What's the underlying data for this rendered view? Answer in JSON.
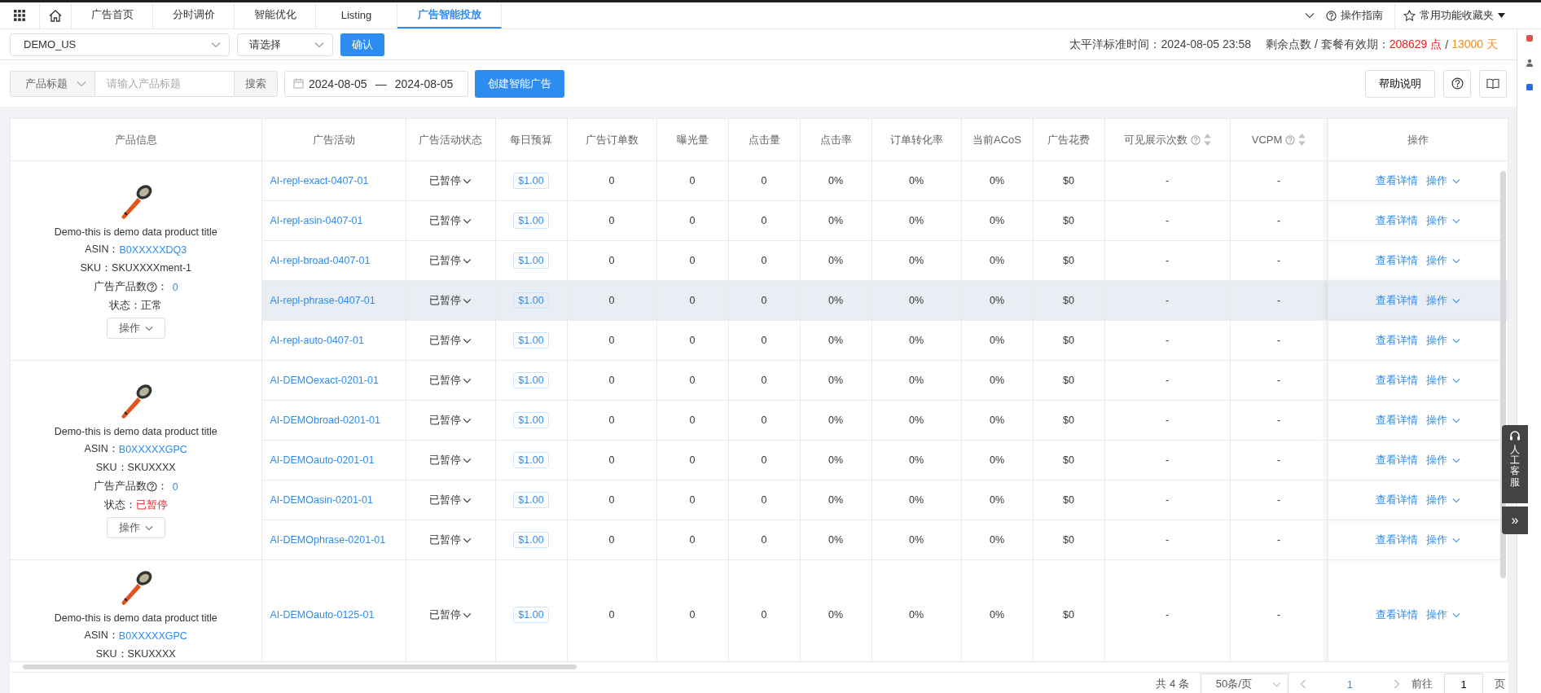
{
  "top_nav": {
    "tabs": [
      {
        "label": "广告首页",
        "selected": false
      },
      {
        "label": "分时调价",
        "selected": false
      },
      {
        "label": "智能优化",
        "selected": false
      },
      {
        "label": "Listing",
        "selected": false
      },
      {
        "label": "广告智能投放",
        "selected": true
      }
    ],
    "guide": "操作指南",
    "favorites": "常用功能收藏夹"
  },
  "account_bar": {
    "store": "DEMO_US",
    "select_placeholder": "请选择",
    "confirm": "确认",
    "time": "太平洋标准时间：2024-08-05 23:58",
    "points_label": "剩余点数 / 套餐有效期：",
    "points": "208629 点",
    "separator": "/",
    "days": "13000 天"
  },
  "filters": {
    "field": "产品标题",
    "search_placeholder": "请输入产品标题",
    "search_button": "搜索",
    "date_start": "2024-08-05",
    "date_sep": "—",
    "date_end": "2024-08-05",
    "create_button": "创建智能广告",
    "help_button": "帮助说明"
  },
  "table": {
    "columns": [
      {
        "label": "产品信息",
        "help": false,
        "sortable": false
      },
      {
        "label": "广告活动",
        "help": false,
        "sortable": false
      },
      {
        "label": "广告活动状态",
        "help": false,
        "sortable": false
      },
      {
        "label": "每日预算",
        "help": false,
        "sortable": false
      },
      {
        "label": "广告订单数",
        "help": false,
        "sortable": false
      },
      {
        "label": "曝光量",
        "help": false,
        "sortable": false
      },
      {
        "label": "点击量",
        "help": false,
        "sortable": false
      },
      {
        "label": "点击率",
        "help": false,
        "sortable": false
      },
      {
        "label": "订单转化率",
        "help": false,
        "sortable": false
      },
      {
        "label": "当前ACoS",
        "help": false,
        "sortable": false
      },
      {
        "label": "广告花费",
        "help": false,
        "sortable": false
      },
      {
        "label": "可见展示次数",
        "help": true,
        "sortable": true
      },
      {
        "label": "VCPM",
        "help": true,
        "sortable": true
      },
      {
        "label": "操作",
        "help": false,
        "sortable": false
      }
    ],
    "products": [
      {
        "title": "Demo-this is demo data product title",
        "asin_label": "ASIN：",
        "asin": "B0XXXXXDQ3",
        "sku": "SKU：SKUXXXXment-1",
        "count_label": "广告产品数",
        "count_sep": "：",
        "count": "0",
        "status_label": "状态：",
        "status": "正常",
        "paused": false,
        "action": "操作",
        "campaigns": [
          {
            "name": "AI-repl-exact-0407-01",
            "status": "已暂停",
            "budget": "$1.00",
            "metrics": [
              "0",
              "0",
              "0",
              "0%",
              "0%",
              "0%",
              "$0",
              "-",
              "-"
            ],
            "details": "查看详情",
            "action": "操作",
            "highlighted": false
          },
          {
            "name": "AI-repl-asin-0407-01",
            "status": "已暂停",
            "budget": "$1.00",
            "metrics": [
              "0",
              "0",
              "0",
              "0%",
              "0%",
              "0%",
              "$0",
              "-",
              "-"
            ],
            "details": "查看详情",
            "action": "操作",
            "highlighted": false
          },
          {
            "name": "AI-repl-broad-0407-01",
            "status": "已暂停",
            "budget": "$1.00",
            "metrics": [
              "0",
              "0",
              "0",
              "0%",
              "0%",
              "0%",
              "$0",
              "-",
              "-"
            ],
            "details": "查看详情",
            "action": "操作",
            "highlighted": false
          },
          {
            "name": "AI-repl-phrase-0407-01",
            "status": "已暂停",
            "budget": "$1.00",
            "metrics": [
              "0",
              "0",
              "0",
              "0%",
              "0%",
              "0%",
              "$0",
              "-",
              "-"
            ],
            "details": "查看详情",
            "action": "操作",
            "highlighted": true
          },
          {
            "name": "AI-repl-auto-0407-01",
            "status": "已暂停",
            "budget": "$1.00",
            "metrics": [
              "0",
              "0",
              "0",
              "0%",
              "0%",
              "0%",
              "$0",
              "-",
              "-"
            ],
            "details": "查看详情",
            "action": "操作",
            "highlighted": false
          }
        ]
      },
      {
        "title": "Demo-this is demo data product title",
        "asin_label": "ASIN：",
        "asin": "B0XXXXXGPC",
        "sku": "SKU：SKUXXXX",
        "count_label": "广告产品数",
        "count_sep": "：",
        "count": "0",
        "status_label": "状态：",
        "status": "已暂停",
        "paused": true,
        "action": "操作",
        "campaigns": [
          {
            "name": "AI-DEMOexact-0201-01",
            "status": "已暂停",
            "budget": "$1.00",
            "metrics": [
              "0",
              "0",
              "0",
              "0%",
              "0%",
              "0%",
              "$0",
              "-",
              "-"
            ],
            "details": "查看详情",
            "action": "操作",
            "highlighted": false
          },
          {
            "name": "AI-DEMObroad-0201-01",
            "status": "已暂停",
            "budget": "$1.00",
            "metrics": [
              "0",
              "0",
              "0",
              "0%",
              "0%",
              "0%",
              "$0",
              "-",
              "-"
            ],
            "details": "查看详情",
            "action": "操作",
            "highlighted": false
          },
          {
            "name": "AI-DEMOauto-0201-01",
            "status": "已暂停",
            "budget": "$1.00",
            "metrics": [
              "0",
              "0",
              "0",
              "0%",
              "0%",
              "0%",
              "$0",
              "-",
              "-"
            ],
            "details": "查看详情",
            "action": "操作",
            "highlighted": false
          },
          {
            "name": "AI-DEMOasin-0201-01",
            "status": "已暂停",
            "budget": "$1.00",
            "metrics": [
              "0",
              "0",
              "0",
              "0%",
              "0%",
              "0%",
              "$0",
              "-",
              "-"
            ],
            "details": "查看详情",
            "action": "操作",
            "highlighted": false
          },
          {
            "name": "AI-DEMOphrase-0201-01",
            "status": "已暂停",
            "budget": "$1.00",
            "metrics": [
              "0",
              "0",
              "0",
              "0%",
              "0%",
              "0%",
              "$0",
              "-",
              "-"
            ],
            "details": "查看详情",
            "action": "操作",
            "highlighted": false
          }
        ]
      },
      {
        "title": "Demo-this is demo data product title",
        "asin_label": "ASIN：",
        "asin": "B0XXXXXGPC",
        "sku": "SKU：SKUXXXX",
        "campaigns": [
          {
            "name": "AI-DEMOauto-0125-01",
            "status": "已暂停",
            "budget": "$1.00",
            "metrics": [
              "0",
              "0",
              "0",
              "0%",
              "0%",
              "0%",
              "$0",
              "-",
              "-"
            ],
            "details": "查看详情",
            "action": "操作",
            "highlighted": false
          }
        ]
      }
    ]
  },
  "pagination": {
    "total": "共 4 条",
    "page_size": "50条/页",
    "current": "1",
    "goto_label": "前往",
    "goto_value": "1",
    "page_unit": "页"
  },
  "support_widget": {
    "label": "人工客服",
    "collapse": "»"
  }
}
